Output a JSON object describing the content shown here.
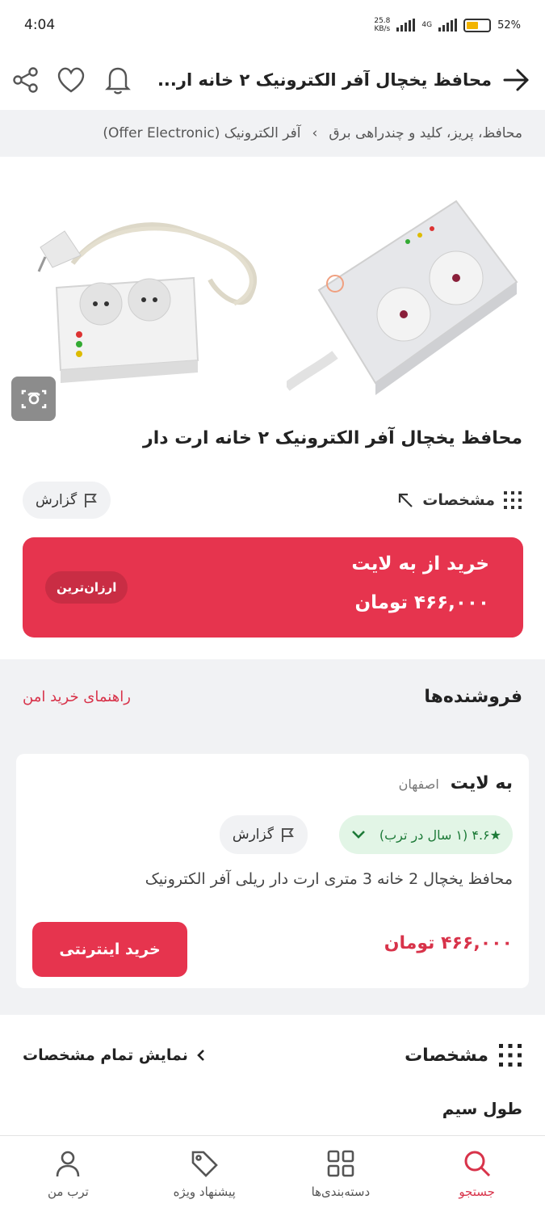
{
  "status_bar": {
    "time": "4:04",
    "net_speed_top": "25.8",
    "net_speed_bottom": "KB/s",
    "network_type": "4G",
    "battery_percent": "52%"
  },
  "header": {
    "title": "محافظ یخچال آفر الکترونیک ۲ خانه ار...",
    "icons": [
      "back-arrow-icon",
      "bell-icon",
      "heart-icon",
      "share-icon"
    ]
  },
  "breadcrumb": {
    "items": [
      "محافظ، پریز، کلید و چندراهی برق",
      "آفر الکترونیک (Offer Electronic)"
    ],
    "separator": "›"
  },
  "product": {
    "title": "محافظ یخچال آفر الکترونیک ۲ خانه ارت دار",
    "specs_label": "مشخصات",
    "report_label": "گزارش",
    "buy_from": "خرید از به لایت",
    "price": "۴۶۶,۰۰۰ تومان",
    "cheapest_badge": "ارزان‌ترین"
  },
  "sellers": {
    "heading": "فروشنده‌ها",
    "guide_link": "راهنمای خرید امن",
    "card": {
      "name": "به لایت",
      "city": "اصفهان",
      "rating": "★۴.۶ (۱ سال در ترب)",
      "report_label": "گزارش",
      "description": "محافظ یخچال 2 خانه 3 متری ارت دار ریلی آفر الکترونیک",
      "price": "۴۶۶,۰۰۰ تومان",
      "buy_button": "خرید اینترنتی"
    }
  },
  "specs_section": {
    "heading": "مشخصات",
    "show_all": "نمایش تمام مشخصات",
    "first_item": "طول سیم"
  },
  "bottom_nav": {
    "items": [
      {
        "label": "جستجو",
        "icon": "search-icon",
        "active": true
      },
      {
        "label": "دسته‌بندی‌ها",
        "icon": "grid-icon",
        "active": false
      },
      {
        "label": "پیشنهاد ویژه",
        "icon": "tag-icon",
        "active": false
      },
      {
        "label": "ترب من",
        "icon": "user-icon",
        "active": false
      }
    ]
  },
  "colors": {
    "accent": "#e6344e",
    "accent_text": "#d8334a",
    "rating_bg": "#e2f5e6",
    "rating_text": "#1d7a38",
    "section_bg": "#f1f2f4"
  }
}
